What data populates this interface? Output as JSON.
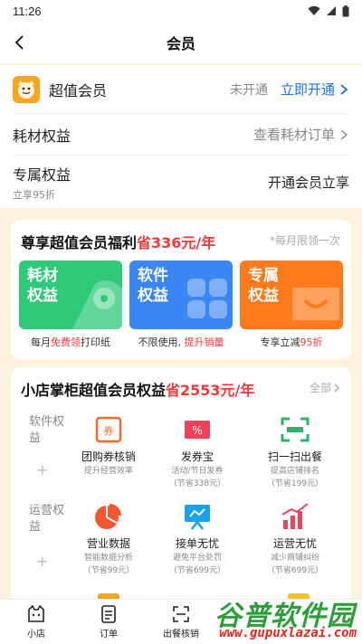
{
  "status": {
    "time": "11:26"
  },
  "nav": {
    "title": "会员"
  },
  "membership": {
    "name": "超值会员",
    "status": "未开通",
    "action": "立即开通"
  },
  "consumables": {
    "label": "耗材权益",
    "link": "查看耗材订单"
  },
  "exclusive": {
    "label": "专属权益",
    "sub": "立享95折",
    "link": "开通会员立享"
  },
  "benefits": {
    "title_prefix": "尊享超值会员福利",
    "title_highlight": "省336元/年",
    "note": "*每月限领一次",
    "tiles": [
      {
        "label": "耗材权益",
        "color": "#2fc97a",
        "caption_a": "每月",
        "caption_b": "免费领",
        "caption_c": "打印纸"
      },
      {
        "label": "软件权益",
        "color": "#3b86f5",
        "caption_a": "不限使用, ",
        "caption_b": "提升销量",
        "caption_c": ""
      },
      {
        "label": "专属权益",
        "color": "#ff7a1a",
        "caption_a": "专享立减",
        "caption_b": "95折",
        "caption_c": ""
      }
    ]
  },
  "shop": {
    "title_prefix": "小店掌柜超值会员权益",
    "title_highlight": "省2553元/年",
    "all": "全部",
    "groups": [
      {
        "label": "软件权益",
        "plus": "+"
      },
      {
        "label": "运营权益",
        "plus": "+"
      }
    ],
    "features": [
      {
        "name": "团购券核销",
        "desc1": "提升经营效率",
        "desc2": "",
        "icon": "coupon-icon"
      },
      {
        "name": "发券宝",
        "desc1": "活动/节日发券",
        "desc2": "（节省338元）",
        "icon": "percent-ticket-icon"
      },
      {
        "name": "扫一扫出餐",
        "desc1": "提高店铺排名",
        "desc2": "（节省199元）",
        "icon": "scan-icon"
      },
      {
        "name": "营业数据",
        "desc1": "智能数据分析",
        "desc2": "（节省99元）",
        "icon": "pie-chart-icon"
      },
      {
        "name": "接单无忧",
        "desc1": "避免平台处罚",
        "desc2": "（节省699元）",
        "icon": "presentation-icon"
      },
      {
        "name": "运营无忧",
        "desc1": "减少商铺纠纷",
        "desc2": "（节省699元）",
        "icon": "bar-chart-icon"
      }
    ]
  },
  "tabs": [
    {
      "label": "小店",
      "icon": "shop-cat-icon"
    },
    {
      "label": "订单",
      "icon": "order-icon"
    },
    {
      "label": "出餐核销",
      "icon": "scan-frame-icon"
    }
  ],
  "watermark": {
    "cn": "谷普软件园",
    "url": "www.gupuxlazai.com"
  }
}
